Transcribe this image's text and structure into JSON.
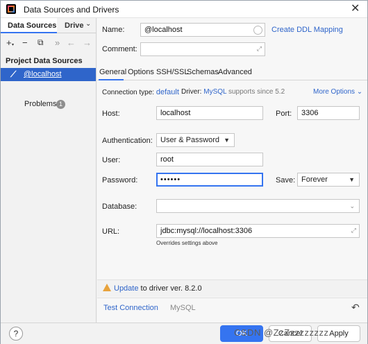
{
  "window": {
    "title": "Data Sources and Drivers",
    "close_glyph": "✕"
  },
  "left_panel": {
    "tab_data_sources": "Data Sources",
    "tab_drivers": "Drive",
    "tab_drivers_chevron": "⌄",
    "toolbar": {
      "add": "+",
      "add_sub": "▾",
      "remove": "−",
      "duplicate": "⧉",
      "more": "»",
      "back": "←",
      "forward": "→"
    },
    "section_title": "Project Data Sources",
    "item_label": "@localhost",
    "problems_label": "Problems",
    "problems_count": "1"
  },
  "header": {
    "name_label": "Name:",
    "name_value": "@localhost",
    "create_ddl_link": "Create DDL Mapping",
    "comment_label": "Comment:",
    "comment_value": ""
  },
  "tabs": [
    "General",
    "Options",
    "SSH/SSL",
    "Schemas",
    "Advanced"
  ],
  "connection": {
    "type_label": "Connection type:",
    "type_value": "default",
    "driver_label": "Driver:",
    "driver_value": "MySQL",
    "driver_suffix": "supports since 5.2",
    "more_options": "More Options ⌄"
  },
  "form": {
    "host_label": "Host:",
    "host_value": "localhost",
    "port_label": "Port:",
    "port_value": "3306",
    "auth_label": "Authentication:",
    "auth_value": "User & Password",
    "user_label": "User:",
    "user_value": "root",
    "password_label": "Password:",
    "password_value": "••••••",
    "save_label": "Save:",
    "save_value": "Forever",
    "database_label": "Database:",
    "database_value": "",
    "url_label": "URL:",
    "url_value": "jdbc:mysql://localhost:3306",
    "url_hint": "Overrides settings above"
  },
  "warning": {
    "link": "Update",
    "text": "to driver ver. 8.2.0"
  },
  "bottom": {
    "test_connection": "Test Connection",
    "driver_name": "MySQL",
    "reset_glyph": "↶"
  },
  "footer": {
    "help": "?",
    "ok": "OK",
    "cancel": "Cancel",
    "apply": "Apply",
    "watermark": "CSDN @ZzZzzzzzzzz"
  },
  "colors": {
    "accent": "#3574f0",
    "selection": "#2f65ca",
    "link": "#2f65ca",
    "warning": "#e8a33d"
  }
}
